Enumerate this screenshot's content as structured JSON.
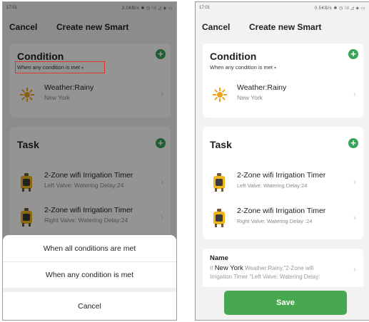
{
  "status_bar": {
    "time": "17:01",
    "left_network": "3.0KB/s",
    "right_network": "0.5KB/s",
    "icons": "✱ ◷ ⁞ıl ◿ ◈ ▭"
  },
  "nav": {
    "cancel_label": "Cancel",
    "title": "Create new Smart"
  },
  "condition": {
    "title": "Condition",
    "mode_label": "When any condition is met",
    "mode_caret": "▾",
    "items": [
      {
        "title": "Weather:Rainy",
        "subtitle": "New York",
        "icon": "sun-icon"
      }
    ]
  },
  "task": {
    "title": "Task",
    "items": [
      {
        "title": "2-Zone wifi Irrigation Timer",
        "subtitle_left": "Left Valve: Watering Delay:24",
        "subtitle_right": "Left Valve: Watering Delay:24",
        "icon": "irrigation-timer-icon"
      },
      {
        "title": "2-Zone wifi Irrigation Timer",
        "subtitle_left": "Right Valve: Watering Delay:24",
        "subtitle_right": "Right Valve: Watering Delay :24",
        "icon": "irrigation-timer-icon"
      }
    ]
  },
  "sheet": {
    "option_all": "When all conditions are met",
    "option_any": "When any condition is met",
    "cancel_label": "Cancel"
  },
  "name_section": {
    "label": "Name",
    "prefix": "If",
    "location": "New York",
    "line_1_rest": "Weather:Rainy,\"2-Zone wifi",
    "line_2": "Irrigation Timer \"Left Valve: Watering Delay:"
  },
  "save_label": "Save",
  "colors": {
    "accent_green": "#3aa35a",
    "save_green": "#48a84f",
    "highlight_red": "#e03131",
    "sun": "#f0a21f",
    "timer_yellow": "#f1b51a"
  },
  "icons": {
    "add": "+",
    "chevron": "›"
  }
}
